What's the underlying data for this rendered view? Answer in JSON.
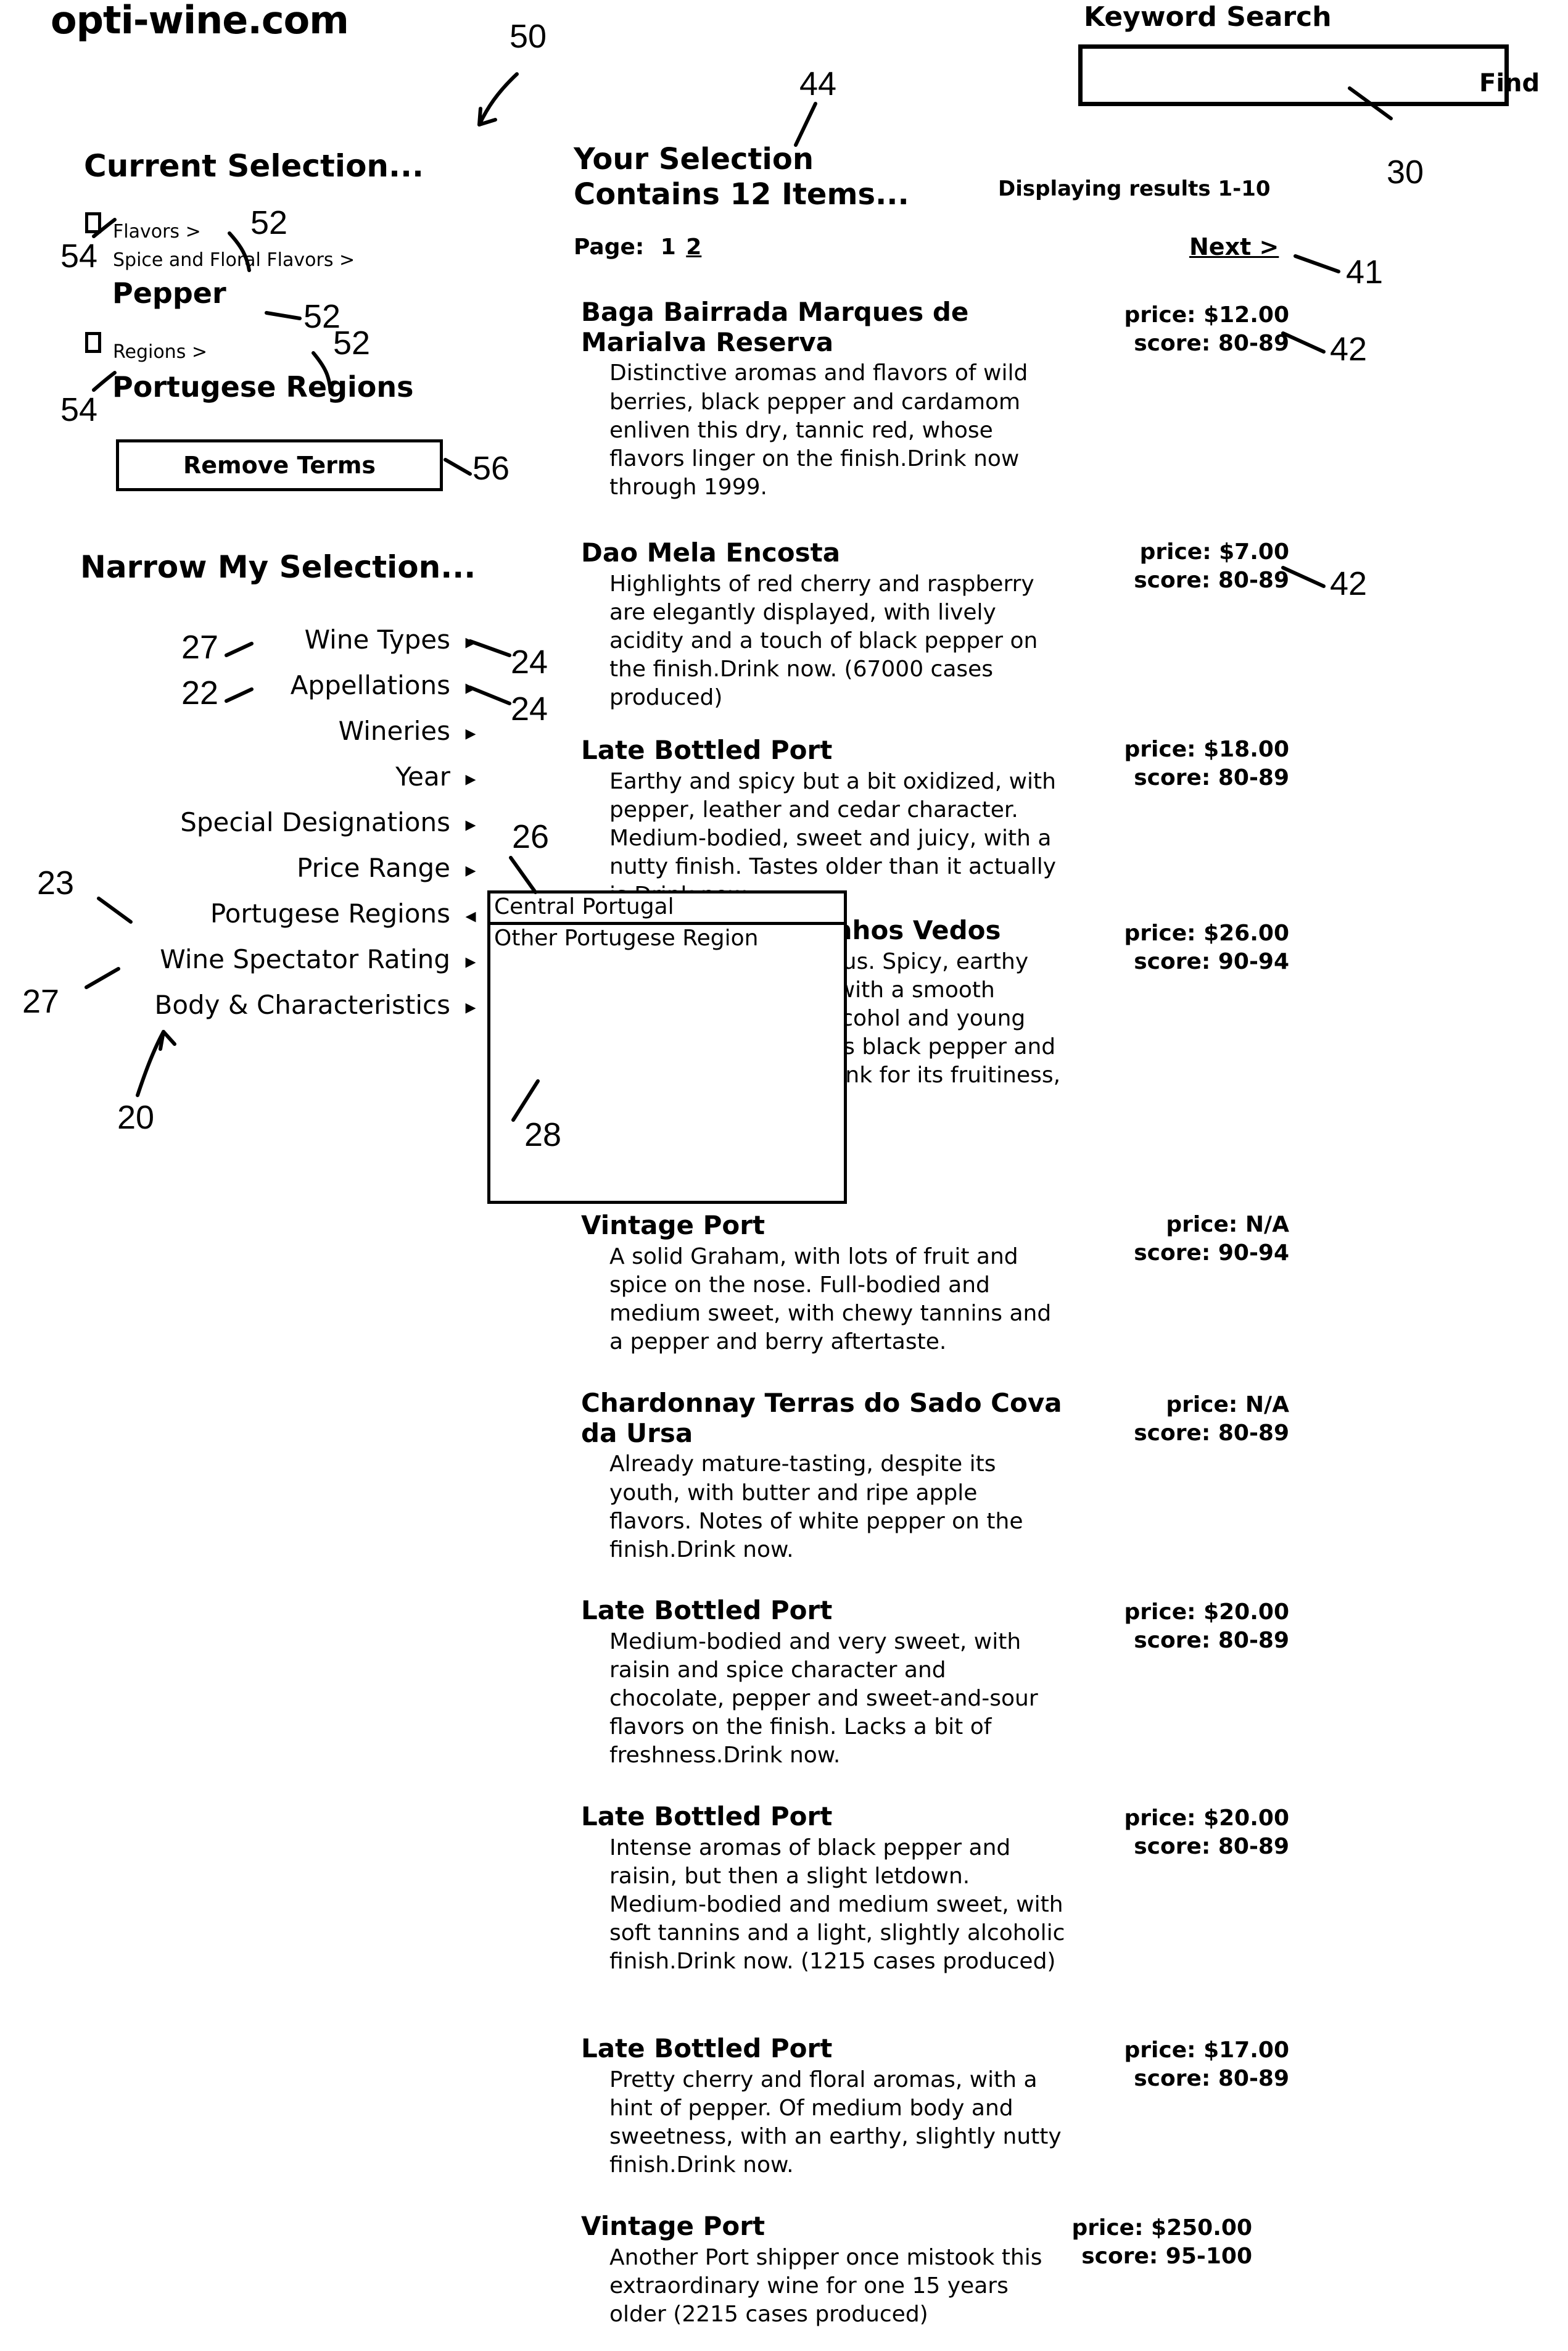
{
  "brand": "opti-wine.com",
  "search": {
    "label": "Keyword Search",
    "value": "",
    "placeholder": "",
    "find_label": "Find"
  },
  "current_selection": {
    "heading": "Current Selection...",
    "terms": [
      {
        "crumb": "Flavors >",
        "subcrumb": "Spice and Floral Flavors >",
        "value": "Pepper"
      },
      {
        "crumb": "Regions >",
        "subcrumb": "",
        "value": "Portugese Regions"
      }
    ],
    "remove_button": "Remove Terms"
  },
  "narrow_selection": {
    "heading": "Narrow My Selection...",
    "items": [
      {
        "label": "Wine Types",
        "arrow": "▸",
        "expanded": false
      },
      {
        "label": "Appellations",
        "arrow": "▸",
        "expanded": false
      },
      {
        "label": "Wineries",
        "arrow": "▸",
        "expanded": false
      },
      {
        "label": "Year",
        "arrow": "▸",
        "expanded": false
      },
      {
        "label": "Special Designations",
        "arrow": "▸",
        "expanded": false
      },
      {
        "label": "Price Range",
        "arrow": "▸",
        "expanded": false
      },
      {
        "label": "Portugese Regions",
        "arrow": "◂",
        "expanded": true
      },
      {
        "label": "Wine Spectator Rating",
        "arrow": "▸",
        "expanded": false
      },
      {
        "label": "Body & Characteristics",
        "arrow": "▸",
        "expanded": false
      }
    ],
    "dropdown": {
      "options": [
        {
          "label": "Central Portugal",
          "selected": true
        },
        {
          "label": "Other Portugese Region",
          "selected": false
        }
      ]
    }
  },
  "results": {
    "heading_line1": "Your Selection",
    "heading_line2": "Contains 12 Items...",
    "displaying": "Displaying results 1-10",
    "page_label": "Page:",
    "pages": [
      "1",
      "2"
    ],
    "current_page": "1",
    "next_label": "Next >",
    "items": [
      {
        "title": "Baga Bairrada Marques de Marialva Reserva",
        "desc": "Distinctive aromas and flavors of wild berries, black pepper and cardamom enliven this dry, tannic red, whose flavors linger on the finish.Drink now through 1999.",
        "price": "price: $12.00",
        "score": "score: 80-89"
      },
      {
        "title": "Dao Mela Encosta",
        "desc": "Highlights of red cherry and raspberry are elegantly displayed, with lively acidity and a touch of black pepper on the finish.Drink now. (67000 cases produced)",
        "price": "price: $7.00",
        "score": "score: 80-89"
      },
      {
        "title": "Late Bottled Port",
        "desc": "Earthy and spicy but a bit oxidized, with pepper, leather and cedar character. Medium-bodied, sweet and juicy, with a nutty finish. Tastes older than it actually is.Drink now.",
        "price": "price: $18.00",
        "score": "score: 80-89"
      },
      {
        "title": "Arruda Lezirao Vinhos Vedos",
        "desc": "Ripe, rich and delicious. Spicy, earthy and fruity in aroma, with a smooth texture and lots of alcohol and young tannins. Finish echoes black pepper and slate. Tempting to drink for its fruitiness, but proba",
        "price": "price: $26.00",
        "score": "score: 90-94"
      },
      {
        "title": "Vintage Port",
        "desc": "A solid Graham, with lots of fruit and spice on the nose. Full-bodied and medium sweet, with chewy tannins and a pepper and berry aftertaste.",
        "price": "price: N/A",
        "score": "score: 90-94"
      },
      {
        "title": "Chardonnay Terras do Sado Cova da Ursa",
        "desc": "Already mature-tasting, despite its youth, with butter and ripe apple flavors. Notes of white pepper on the finish.Drink now.",
        "price": "price: N/A",
        "score": "score: 80-89"
      },
      {
        "title": "Late Bottled Port",
        "desc": "Medium-bodied and very sweet, with raisin and spice character and chocolate, pepper and sweet-and-sour flavors on the finish. Lacks a bit of freshness.Drink now.",
        "price": "price: $20.00",
        "score": "score: 80-89"
      },
      {
        "title": "Late Bottled Port",
        "desc": "Intense aromas of black pepper and raisin, but then a slight letdown. Medium-bodied and medium sweet, with soft tannins and a light, slightly alcoholic finish.Drink now. (1215 cases produced)",
        "price": "price: $20.00",
        "score": "score: 80-89"
      },
      {
        "title": "Late Bottled Port",
        "desc": "Pretty cherry and floral aromas, with a hint of pepper. Of medium body and sweetness, with an earthy, slightly nutty finish.Drink now.",
        "price": "price: $17.00",
        "score": "score: 80-89"
      },
      {
        "title": "Vintage Port",
        "desc": "Another Port shipper once mistook this extraordinary wine for one 15 years older  (2215 cases produced)",
        "price": "price: $250.00",
        "score": "score: 95-100"
      }
    ]
  },
  "reference_numerals": [
    {
      "id": "ref-50",
      "text": "50"
    },
    {
      "id": "ref-44",
      "text": "44"
    },
    {
      "id": "ref-30",
      "text": "30"
    },
    {
      "id": "ref-41",
      "text": "41"
    },
    {
      "id": "ref-42a",
      "text": "42"
    },
    {
      "id": "ref-42b",
      "text": "42"
    },
    {
      "id": "ref-52a",
      "text": "52"
    },
    {
      "id": "ref-52b",
      "text": "52"
    },
    {
      "id": "ref-52c",
      "text": "52"
    },
    {
      "id": "ref-54a",
      "text": "54"
    },
    {
      "id": "ref-54b",
      "text": "54"
    },
    {
      "id": "ref-56",
      "text": "56"
    },
    {
      "id": "ref-27a",
      "text": "27"
    },
    {
      "id": "ref-22",
      "text": "22"
    },
    {
      "id": "ref-24a",
      "text": "24"
    },
    {
      "id": "ref-24b",
      "text": "24"
    },
    {
      "id": "ref-26",
      "text": "26"
    },
    {
      "id": "ref-23",
      "text": "23"
    },
    {
      "id": "ref-27b",
      "text": "27"
    },
    {
      "id": "ref-28",
      "text": "28"
    },
    {
      "id": "ref-20",
      "text": "20"
    }
  ]
}
